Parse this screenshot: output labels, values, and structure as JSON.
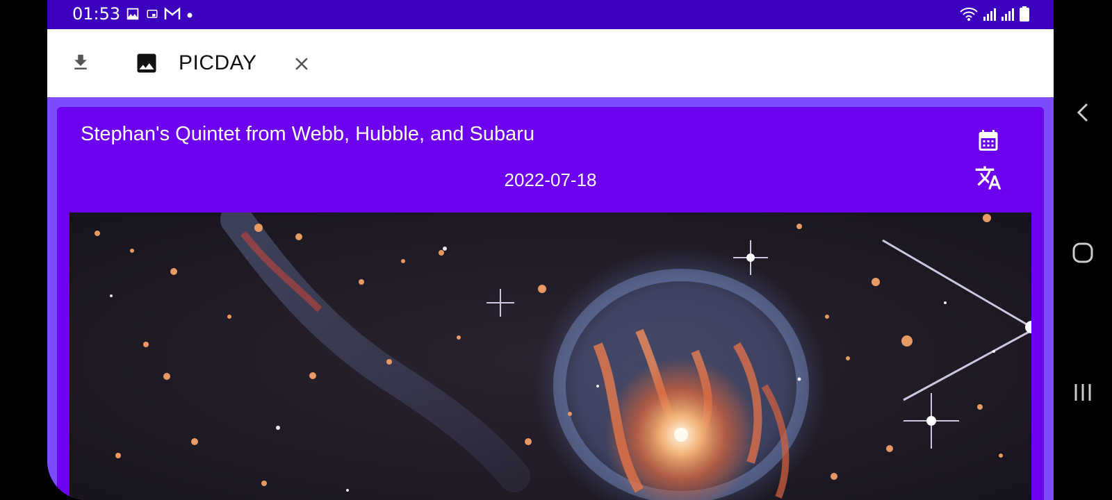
{
  "status": {
    "time": "01:53",
    "left_icons": [
      "image-icon",
      "cast-icon",
      "gmail-icon",
      "dot-icon"
    ],
    "right_icons": [
      "wifi-icon",
      "signal-icon",
      "signal-icon",
      "battery-icon"
    ]
  },
  "appbar": {
    "title": "PICDAY",
    "download_icon": "download-icon",
    "image_icon": "image-icon",
    "close_icon": "close-icon"
  },
  "card": {
    "title": "Stephan's Quintet from Webb, Hubble, and Subaru",
    "date": "2022-07-18",
    "calendar_icon": "calendar-icon",
    "translate_icon": "translate-icon"
  },
  "nav": {
    "buttons": [
      "back-icon",
      "home-icon",
      "recents-icon"
    ]
  },
  "colors": {
    "status_bar": "#3c00bf",
    "accent": "#6d00ee",
    "background": "#7c4dff",
    "appbar": "#ffffff"
  }
}
